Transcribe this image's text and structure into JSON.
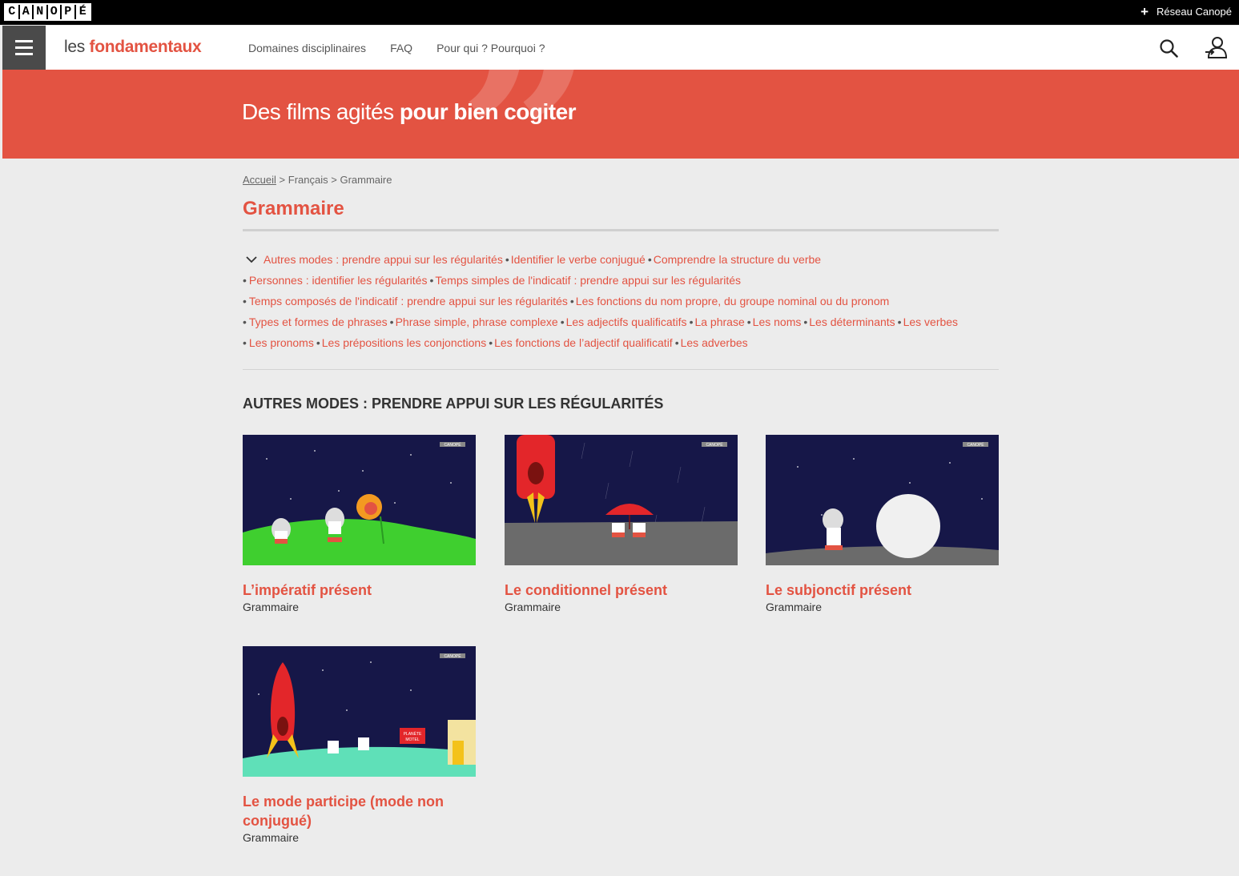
{
  "topbar": {
    "logo_letters": [
      "C",
      "A",
      "N",
      "O",
      "P",
      "É"
    ],
    "reseau_label": "Réseau Canopé"
  },
  "header": {
    "brand_les": "les",
    "brand_fond": "fondamentaux",
    "nav": [
      "Domaines disciplinaires",
      "FAQ",
      "Pour qui ? Pourquoi ?"
    ]
  },
  "banner": {
    "slogan_light": "Des films agités",
    "slogan_bold": "pour bien cogiter"
  },
  "breadcrumb": {
    "home": "Accueil",
    "sep": ">",
    "level1": "Français",
    "level2": "Grammaire"
  },
  "page_title": "Grammaire",
  "topics": [
    "Autres modes : prendre appui sur les régularités",
    "Identifier le verbe conjugué",
    "Comprendre la structure du verbe",
    "Personnes : identifier les régularités",
    "Temps simples de l'indicatif : prendre appui sur les régularités",
    "Temps composés de l'indicatif : prendre appui sur les régularités",
    "Les fonctions du nom propre, du groupe nominal ou du pronom",
    "Types et formes de phrases",
    "Phrase simple, phrase complexe",
    "Les adjectifs qualificatifs",
    "La phrase",
    "Les noms",
    "Les déterminants",
    "Les verbes",
    "Les pronoms",
    "Les prépositions les conjonctions",
    "Les fonctions de l’adjectif qualificatif",
    "Les adverbes"
  ],
  "section_title": "AUTRES MODES : PRENDRE APPUI SUR LES RÉGULARITÉS",
  "cards": [
    {
      "title": "L’impératif présent",
      "subtitle": "Grammaire"
    },
    {
      "title": "Le conditionnel présent",
      "subtitle": "Grammaire"
    },
    {
      "title": "Le subjonctif présent",
      "subtitle": "Grammaire"
    },
    {
      "title": "Le mode participe (mode non conjugué)",
      "subtitle": "Grammaire"
    }
  ],
  "thumb_labels": {
    "canope_tag": "CANOPÉ",
    "planete": "PLANÈTE",
    "motel": "MOTEL"
  },
  "colors": {
    "accent": "#e35342",
    "night": "#161748",
    "grass": "#3fcf2f",
    "moon": "#6b6b6b",
    "mint": "#5fe0b8"
  }
}
